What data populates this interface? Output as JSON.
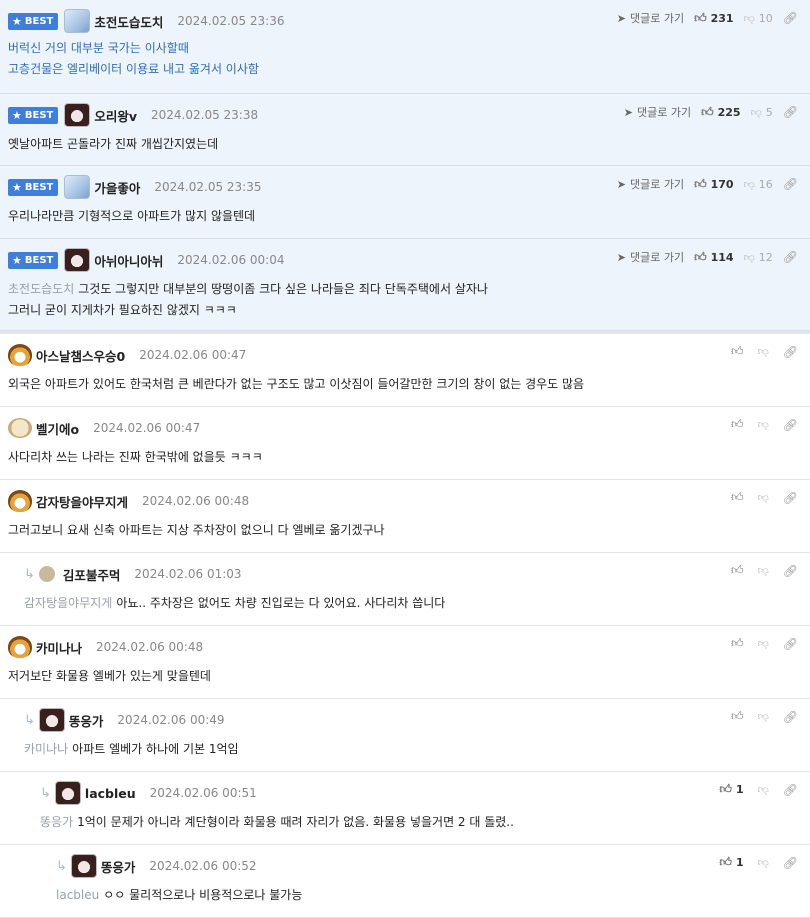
{
  "best_label": "BEST",
  "reply_label": "댓글로 가기",
  "comments": [
    {
      "author": "초전도습도치",
      "date": "2024.02.05 23:36",
      "lines": [
        "버럭신 거의 대부분 국가는 이사할때",
        "고층건물은 엘리베이터 이용료 내고 옮겨서 이사함"
      ],
      "up": "231",
      "down": "10"
    },
    {
      "author": "오리왕v",
      "date": "2024.02.05 23:38",
      "text": "옛날아파트 곤돌라가 진짜 개씹간지였는데",
      "up": "225",
      "down": "5"
    },
    {
      "author": "가을좋아",
      "date": "2024.02.05 23:35",
      "text": "우리나라만큼 기형적으로 아파트가 많지 않을텐데",
      "up": "170",
      "down": "16"
    },
    {
      "author": "아뉘아니아뉘",
      "date": "2024.02.06 00:04",
      "mention": "초전도습도치",
      "lines": [
        "그것도 그렇지만 대부분의 땅떵이좀 크다 싶은 나라들은 죄다 단독주택에서 살자나",
        "그러니 굳이 지게차가 필요하진 않겠지 ㅋㅋㅋ"
      ],
      "up": "114",
      "down": "12"
    },
    {
      "author": "아스날챔스우승0",
      "date": "2024.02.06 00:47",
      "text": "외국은 아파트가 있어도 한국처럼 큰 베란다가 없는 구조도 많고 이삿짐이 들어갈만한 크기의 창이 없는 경우도 많음"
    },
    {
      "author": "벨기에o",
      "date": "2024.02.06 00:47",
      "text": "사다리차 쓰는 나라는 진짜 한국밖에 없을듯 ㅋㅋㅋ"
    },
    {
      "author": "감자탕을야무지게",
      "date": "2024.02.06 00:48",
      "text": "그러고보니 요새 신축 아파트는 지상 주차장이 없으니 다 엘베로 옮기겠구나"
    },
    {
      "author": "김포불주먹",
      "date": "2024.02.06 01:03",
      "mention": "감자탕을야무지게",
      "text": "아뇨.. 주차장은 없어도 차량 진입로는 다 있어요. 사다리차 씁니다"
    },
    {
      "author": "카미나나",
      "date": "2024.02.06 00:48",
      "text": "저거보단 화물용 엘베가 있는게 맞을텐데"
    },
    {
      "author": "똥응가",
      "date": "2024.02.06 00:49",
      "mention": "카미나나",
      "text": "아파트 엘베가 하나에 기본 1억임"
    },
    {
      "author": "lacbleu",
      "date": "2024.02.06 00:51",
      "mention": "똥응가",
      "text": "1억이 문제가 아니라 계단형이라 화물용 때려 자리가 없음. 화물용 넣을거면 2 대 돌렸..",
      "up": "1"
    },
    {
      "author": "똥응가",
      "date": "2024.02.06 00:52",
      "mention": "lacbleu",
      "text": "ㅇㅇ 물리적으로나 비용적으로나 불가능",
      "up": "1"
    }
  ],
  "colors": {
    "accent": "#3d7fd9",
    "best_bg": "#eef4fb"
  }
}
